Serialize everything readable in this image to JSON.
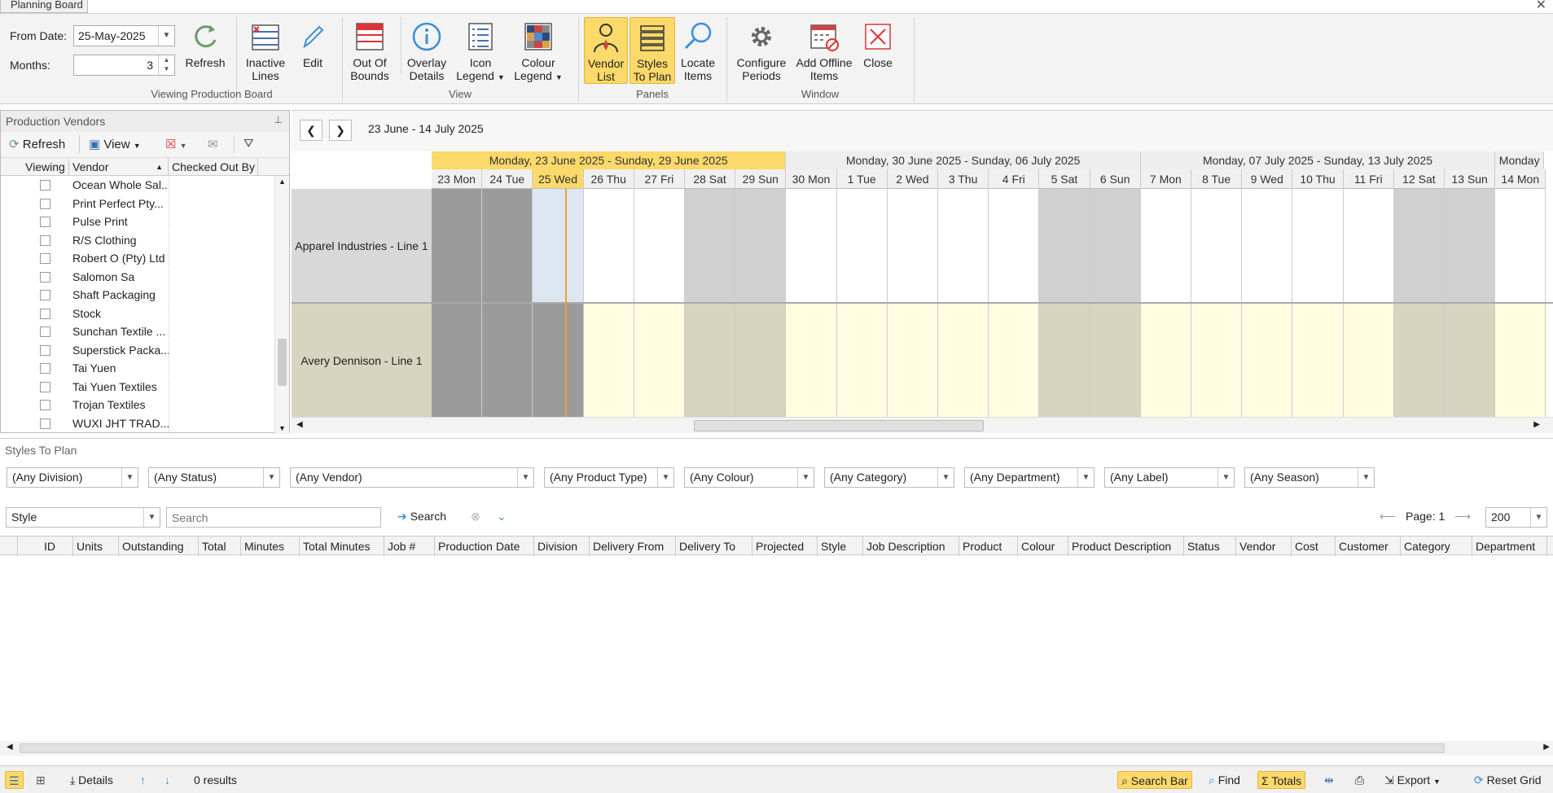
{
  "window": {
    "tab_title": "Planning Board"
  },
  "ribbon": {
    "from_date_label": "From Date:",
    "from_date_value": "25-May-2025",
    "months_label": "Months:",
    "months_value": "3",
    "buttons": {
      "refresh": "Refresh",
      "inactive_lines_1": "Inactive",
      "inactive_lines_2": "Lines",
      "edit": "Edit",
      "out_of_bounds_1": "Out Of",
      "out_of_bounds_2": "Bounds",
      "overlay_details_1": "Overlay",
      "overlay_details_2": "Details",
      "icon_legend_1": "Icon",
      "icon_legend_2": "Legend",
      "colour_legend_1": "Colour",
      "colour_legend_2": "Legend",
      "vendor_list_1": "Vendor",
      "vendor_list_2": "List",
      "styles_to_plan_1": "Styles",
      "styles_to_plan_2": "To Plan",
      "locate_items_1": "Locate",
      "locate_items_2": "Items",
      "configure_periods_1": "Configure",
      "configure_periods_2": "Periods",
      "add_offline_items_1": "Add Offline",
      "add_offline_items_2": "Items",
      "close": "Close"
    },
    "groups": {
      "viewing": "Viewing Production Board",
      "view": "View",
      "panels": "Panels",
      "window": "Window"
    },
    "accent": "#fbd96a"
  },
  "vendors_panel": {
    "title": "Production Vendors",
    "refresh": "Refresh",
    "view": "View",
    "columns": {
      "viewing": "Viewing",
      "vendor": "Vendor",
      "checked_out_by": "Checked Out By"
    },
    "vendors": [
      "Ocean Whole Sal...",
      "Print Perfect Pty...",
      "Pulse Print",
      "R/S Clothing",
      "Robert O (Pty) Ltd",
      "Salomon Sa",
      "Shaft Packaging",
      "Stock",
      "Sunchan Textile ...",
      "Superstick Packa...",
      "Tai Yuen",
      "Tai Yuen Textiles",
      "Trojan Textiles",
      "WUXI JHT TRAD..."
    ]
  },
  "board": {
    "date_range": "23 June - 14 July 2025",
    "weeks": [
      "Monday, 23 June 2025 - Sunday, 29 June 2025",
      "Monday, 30 June 2025 - Sunday, 06 July 2025",
      "Monday, 07 July 2025 - Sunday, 13 July 2025",
      "Monday"
    ],
    "days": [
      "23 Mon",
      "24 Tue",
      "25 Wed",
      "26 Thu",
      "27 Fri",
      "28 Sat",
      "29 Sun",
      "30 Mon",
      "1 Tue",
      "2 Wed",
      "3 Thu",
      "4 Fri",
      "5 Sat",
      "6 Sun",
      "7 Mon",
      "8 Tue",
      "9 Wed",
      "10 Thu",
      "11 Fri",
      "12 Sat",
      "13 Sun",
      "14 Mon"
    ],
    "lines": [
      "Apparel Industries - Line 1",
      "Avery Dennison - Line 1"
    ]
  },
  "styles_to_plan": {
    "title": "Styles To Plan",
    "filters": [
      "(Any Division)",
      "(Any Status)",
      "(Any Vendor)",
      "(Any Product Type)",
      "(Any Colour)",
      "(Any Category)",
      "(Any Department)",
      "(Any Label)",
      "(Any Season)"
    ],
    "search_field": "Style",
    "search_placeholder": "Search",
    "search_button": "Search",
    "page_label": "Page: 1",
    "page_size": "200",
    "columns": [
      "ID",
      "Units",
      "Outstanding",
      "Total",
      "Minutes",
      "Total Minutes",
      "Job #",
      "Production Date",
      "Division",
      "Delivery From",
      "Delivery To",
      "Projected",
      "Style",
      "Job Description",
      "Product",
      "Colour",
      "Product Description",
      "Status",
      "Vendor",
      "Cost",
      "Customer",
      "Category",
      "Department"
    ]
  },
  "statusbar": {
    "details": "Details",
    "results": "0 results",
    "search_bar": "Search Bar",
    "find": "Find",
    "totals": "Totals",
    "export": "Export",
    "reset_grid": "Reset Grid"
  }
}
